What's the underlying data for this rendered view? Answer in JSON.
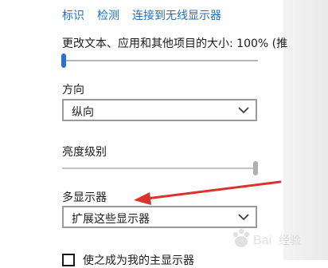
{
  "links": [
    "标识",
    "检测",
    "连接到无线显示器"
  ],
  "scale": {
    "label": "更改文本、应用和其他项目的大小: 100% (推",
    "level": 0
  },
  "orientation": {
    "label": "方向",
    "selected": "纵向"
  },
  "brightness": {
    "label": "亮度级别",
    "level": 100
  },
  "multi_display": {
    "label": "多显示器",
    "selected": "扩展这些显示器"
  },
  "main_display_checkbox": {
    "label": "使之成为我的主显示器",
    "checked": false
  },
  "colors": {
    "accent": "#2a6fd6",
    "link": "#1f6fbf",
    "arrow": "#d9342b"
  },
  "watermark": {
    "text": "Bai 经验"
  }
}
